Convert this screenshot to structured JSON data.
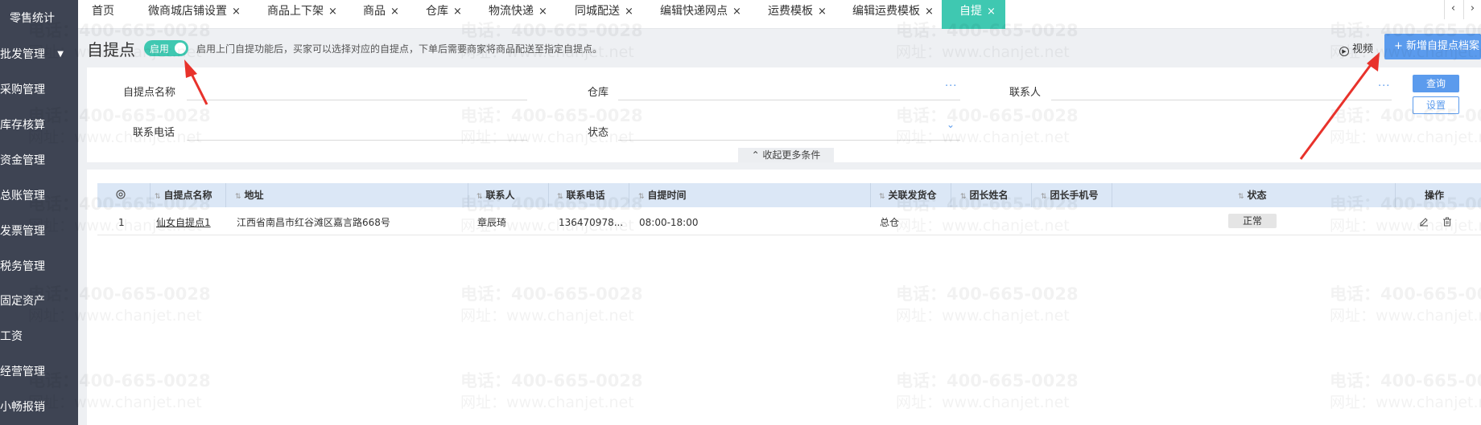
{
  "sidebar": {
    "items": [
      {
        "label": "零售统计",
        "caret": ""
      },
      {
        "label": "批发管理",
        "caret": "▼"
      },
      {
        "label": "采购管理",
        "caret": ""
      },
      {
        "label": "库存核算",
        "caret": ""
      },
      {
        "label": "资金管理",
        "caret": ""
      },
      {
        "label": "总账管理",
        "caret": ""
      },
      {
        "label": "发票管理",
        "caret": ""
      },
      {
        "label": "税务管理",
        "caret": ""
      },
      {
        "label": "固定资产",
        "caret": ""
      },
      {
        "label": "工资",
        "caret": ""
      },
      {
        "label": "经营管理",
        "caret": ""
      },
      {
        "label": "小畅报销",
        "caret": ""
      }
    ]
  },
  "tabs": [
    {
      "label": "首页",
      "close": ""
    },
    {
      "label": "微商城店铺设置",
      "close": "×"
    },
    {
      "label": "商品上下架",
      "close": "×"
    },
    {
      "label": "商品",
      "close": "×"
    },
    {
      "label": "仓库",
      "close": "×"
    },
    {
      "label": "物流快递",
      "close": "×"
    },
    {
      "label": "同城配送",
      "close": "×"
    },
    {
      "label": "编辑快递网点",
      "close": "×"
    },
    {
      "label": "运费模板",
      "close": "×"
    },
    {
      "label": "编辑运费模板",
      "close": "×"
    },
    {
      "label": "自提",
      "close": "×"
    }
  ],
  "tab_controls": {
    "more": "‹",
    "expand": "›"
  },
  "header": {
    "title": "自提点",
    "toggle_label": "启用",
    "toggle_on": true,
    "hint": "启用上门自提功能后，买家可以选择对应的自提点，下单后需要商家将商品配送至指定自提点。",
    "video_label": "视频",
    "new_button": "+ 新增自提点档案"
  },
  "filters": {
    "pickup_name_label": "自提点名称",
    "warehouse_label": "仓库",
    "contact_label": "联系人",
    "phone_label": "联系电话",
    "status_label": "状态",
    "ellipsis": "···",
    "chevron": "⌄",
    "query_button": "查询",
    "settings_button": "设置",
    "collapse_button": "⌃ 收起更多条件"
  },
  "table": {
    "headers": {
      "name": "自提点名称",
      "address": "地址",
      "contact": "联系人",
      "phone": "联系电话",
      "time": "自提时间",
      "warehouse": "关联发货仓",
      "leader_name": "团长姓名",
      "leader_phone": "团长手机号",
      "status": "状态",
      "ops": "操作"
    },
    "rows": [
      {
        "index": "1",
        "name": "仙女自提点1",
        "address": "江西省南昌市红谷滩区嘉言路668号",
        "contact": "章辰琦",
        "phone": "136470978...",
        "time": "08:00-18:00",
        "warehouse": "总仓",
        "leader_name": "",
        "leader_phone": "",
        "status": "正常"
      }
    ]
  },
  "watermark": {
    "phone": "电话：400-665-0028",
    "site": "网址：www.chanjet.net"
  },
  "colors": {
    "sidebar_bg": "#3e4453",
    "accent_teal": "#3fc8b1",
    "primary_blue": "#5b9bed",
    "table_header_bg": "#dbe7f6",
    "annotation_red": "#e8322b"
  }
}
